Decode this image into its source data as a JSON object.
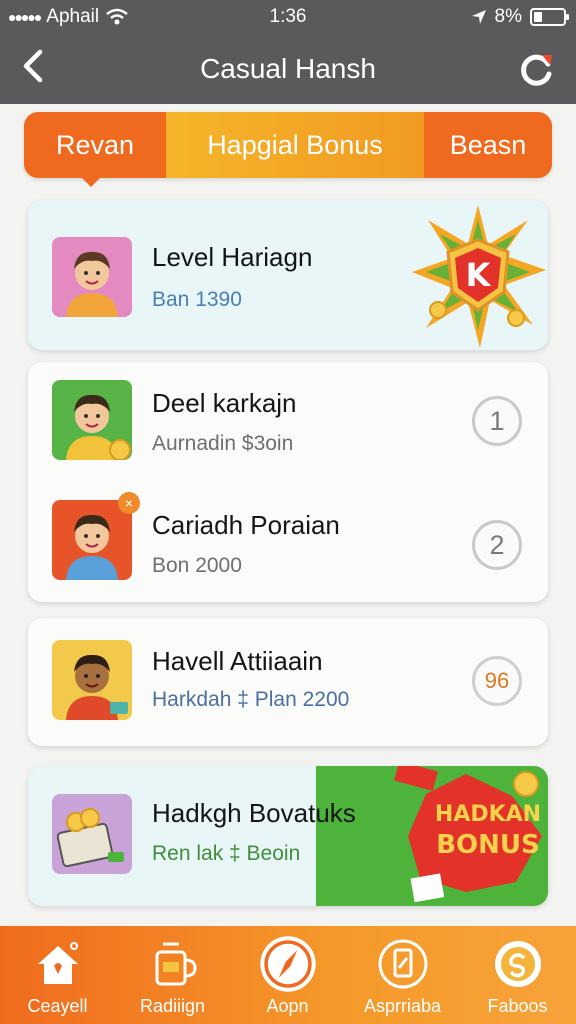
{
  "status": {
    "carrier": "Aphail",
    "time": "1:36",
    "battery": "8%",
    "battery_level": 0.3
  },
  "header": {
    "title": "Casual Hansh"
  },
  "tabs": [
    {
      "label": "Revan"
    },
    {
      "label": "Hapgial Bonus"
    },
    {
      "label": "Beasn"
    }
  ],
  "featured": {
    "name": "Level Hariagn",
    "sub": "Ban 1390",
    "sub_color": "#4a7fb5",
    "badge": "K"
  },
  "list": [
    {
      "name": "Deel karkajn",
      "sub": "Aurnadin $3oin",
      "sub_color": "#6f6f6f",
      "rank": "1"
    },
    {
      "name": "Cariadh Poraian",
      "sub": "Bon 2000",
      "sub_color": "#6f6f6f",
      "rank": "2"
    },
    {
      "name": "Havell Attiiaain",
      "sub": "Harkdah ‡ Plan 2200",
      "sub_color": "#4a6fa0",
      "rank": "96"
    }
  ],
  "promo": {
    "name": "Hadkgh Bovatuks",
    "sub": "Ren lak ‡ Beoin",
    "sub_color": "#3f8f3a",
    "banner_line1": "HADKAN",
    "banner_line2": "BONUS"
  },
  "nav": [
    {
      "label": "Ceayell",
      "icon": "home-icon"
    },
    {
      "label": "Radiiign",
      "icon": "mug-icon"
    },
    {
      "label": "Aopn",
      "icon": "compass-icon"
    },
    {
      "label": "Asprriaba",
      "icon": "tablet-icon"
    },
    {
      "label": "Faboos",
      "icon": "coin-icon"
    }
  ],
  "colors": {
    "accent": "#ef6a1f",
    "accent_light": "#f5b52a",
    "header": "#5a5a5c",
    "green": "#4db33b"
  }
}
